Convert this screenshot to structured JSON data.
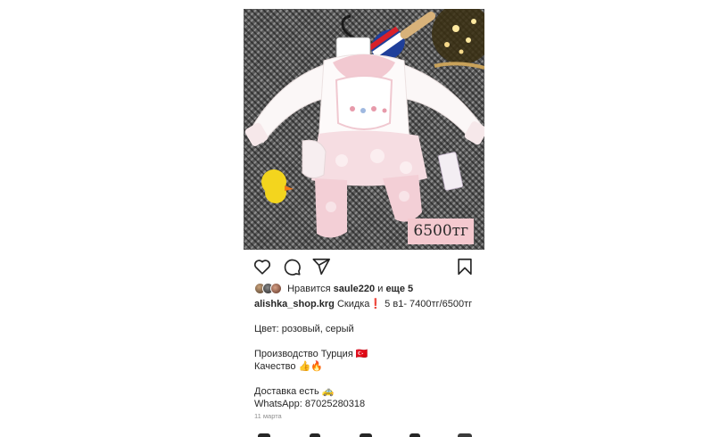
{
  "post": {
    "price_tag": "6500тг",
    "liked_by_prefix": "Нравится",
    "liked_by_user": "saule220",
    "liked_by_and": "и",
    "liked_by_others": "еще 5",
    "username": "alishka_shop.krg",
    "caption_lines": [
      "Скидка❗️ 5 в1- 7400тг/6500тг",
      "",
      "Цвет: розовый, серый",
      "",
      "Производство Турция 🇹🇷",
      "Качество 👍🔥",
      "",
      "Доставка есть 🚕",
      "WhatsApp: 87025280318"
    ],
    "date": "11 марта"
  },
  "icons": {
    "like": "heart-icon",
    "comment": "comment-icon",
    "share": "paper-plane-icon",
    "save": "bookmark-icon"
  },
  "colors": {
    "text": "#262626",
    "muted": "#8e8e8e",
    "price_tag_bg": "#f4c9cf"
  }
}
